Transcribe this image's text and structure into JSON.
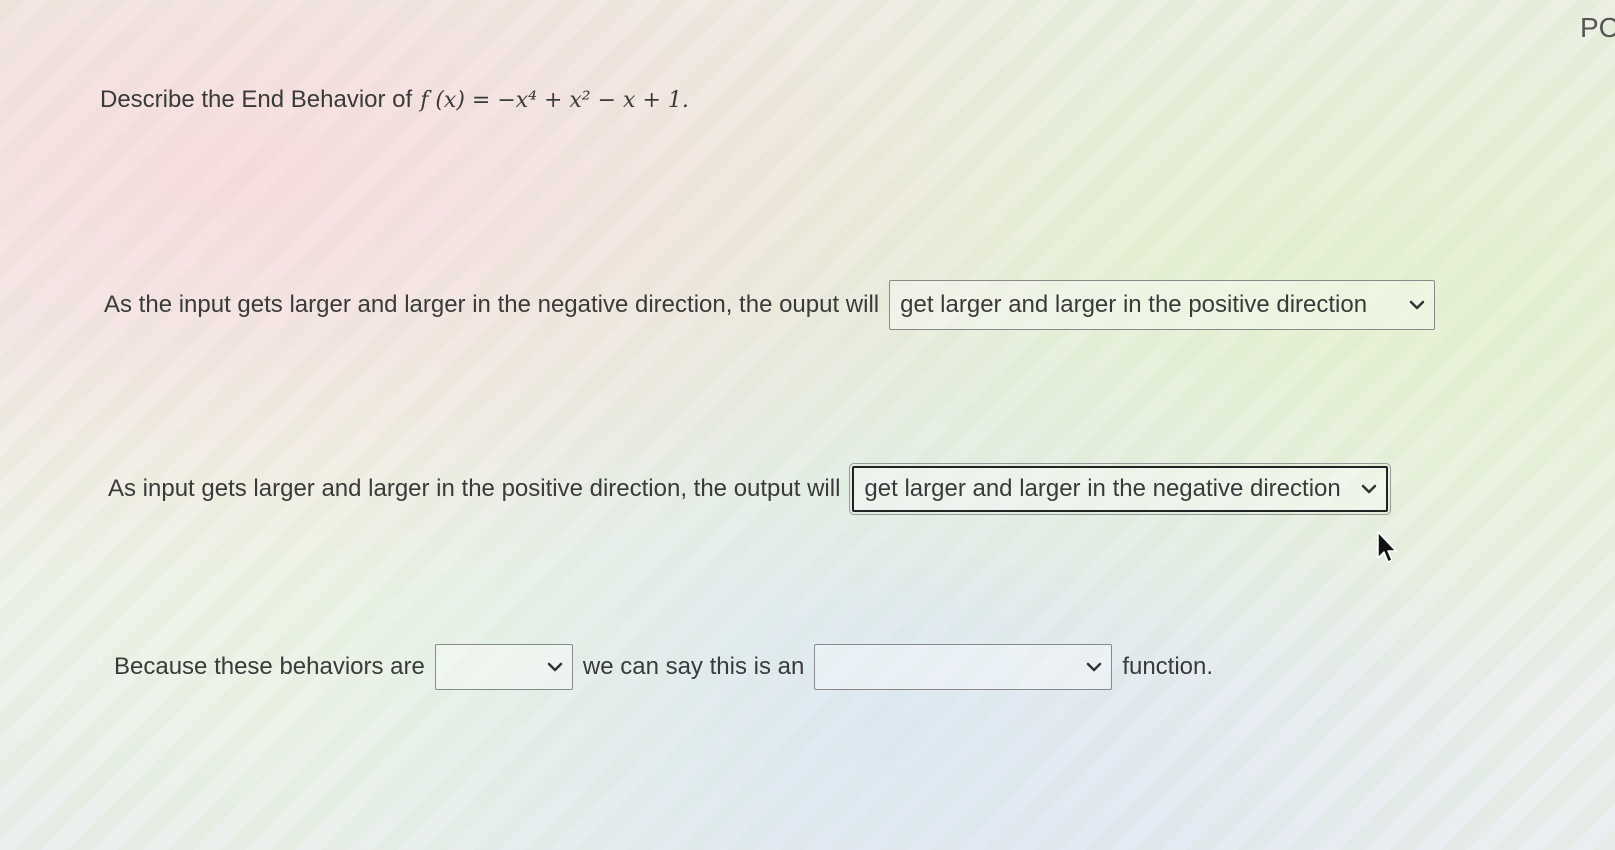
{
  "corner_label": "PC",
  "question": {
    "prompt": "Describe the End Behavior of",
    "function": "f (x) = −x⁴ + x² − x + 1."
  },
  "row1": {
    "text": "As the input gets larger and larger in the negative direction, the ouput will",
    "selected": "get larger and larger in the positive direction"
  },
  "row2": {
    "text": "As input gets larger and larger in the positive direction, the output will",
    "selected": "get larger and larger in the negative direction"
  },
  "row3": {
    "text_before": "Because these behaviors are",
    "selected_1": "",
    "text_middle": "we can say this is an",
    "selected_2": "",
    "text_after": "function."
  },
  "icons": {
    "dropdown": "chevron-down-icon",
    "cursor": "mouse-pointer-icon"
  }
}
